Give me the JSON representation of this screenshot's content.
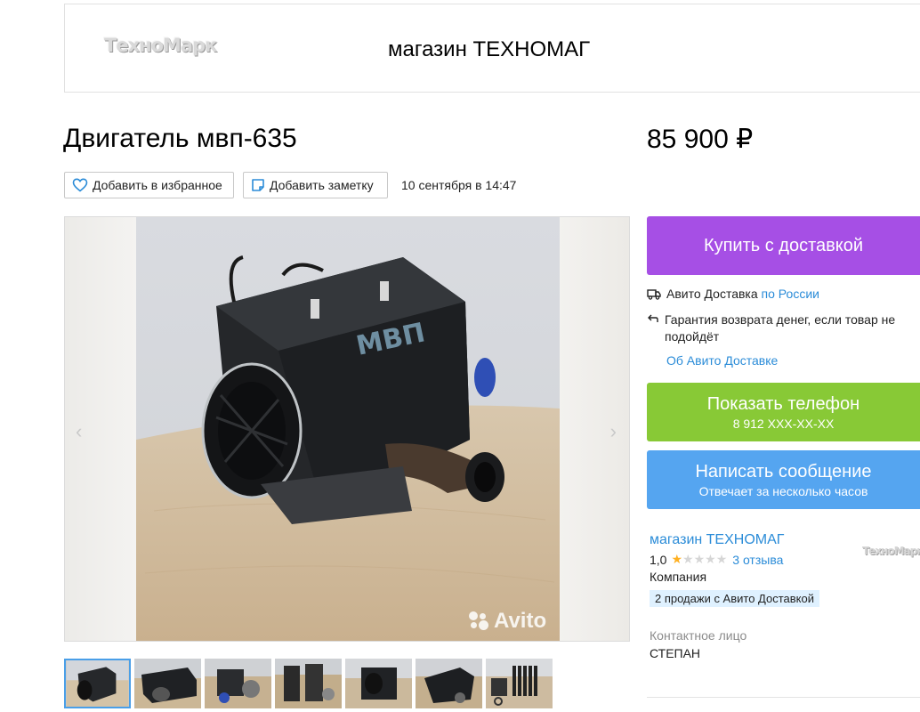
{
  "header": {
    "logo_text": "ТехноМарк",
    "shop_name": "магазин ТЕХНОМАГ"
  },
  "item": {
    "title": "Двигатель мвп-635",
    "price": "85 900 ₽",
    "date": "10 сентября в 14:47"
  },
  "actions": {
    "favorite_label": "Добавить в избранное",
    "note_label": "Добавить заметку"
  },
  "gallery": {
    "watermark": "Avito",
    "active_index": 0,
    "thumbnail_count": 7,
    "photo_text": "МВП"
  },
  "sidebar": {
    "buy_label": "Купить с доставкой",
    "delivery_text": "Авито Доставка",
    "delivery_link": "по России",
    "guarantee_text": "Гарантия возврата денег, если товар не подойдёт",
    "about_delivery_link": "Об Авито Доставке",
    "phone_label": "Показать телефон",
    "phone_number": "8 912 XXX-XX-XX",
    "message_label": "Написать сообщение",
    "message_sub": "Отвечает за несколько часов"
  },
  "seller": {
    "name": "магазин ТЕХНОМАГ",
    "rating": "1,0",
    "rating_stars": 1,
    "rating_max": 5,
    "reviews": "3 отзыва",
    "type": "Компания",
    "badge": "2 продажи с Авито Доставкой",
    "logo_text": "ТехноМарк",
    "contact_label": "Контактное лицо",
    "contact_name": "СТЕПАН"
  },
  "colors": {
    "buy": "#a64fe5",
    "phone": "#88c936",
    "message": "#55a5f0",
    "link": "#2b8cd8",
    "star": "#ffb021"
  }
}
